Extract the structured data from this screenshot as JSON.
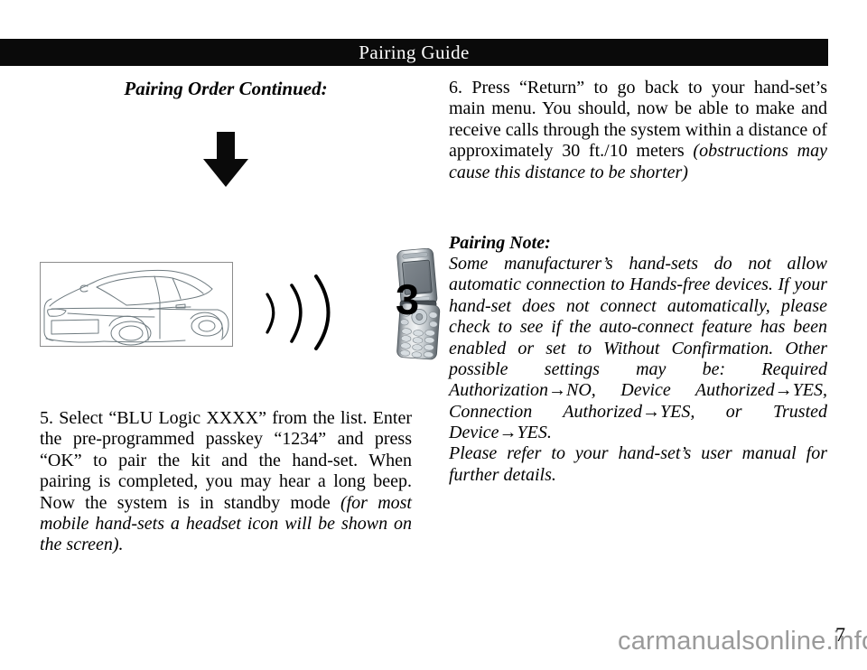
{
  "header": {
    "title": "Pairing Guide"
  },
  "left_column": {
    "heading": "Pairing Order Continued:",
    "arrow_icon": "down-arrow-icon",
    "illustration": {
      "car_alt": "car-line-drawing",
      "signal_alt": "bluetooth-signal-waves",
      "phone_alt": "flip-phone-illustration",
      "step_number": "3"
    },
    "step5": {
      "text_plain": "5. Select “BLU Logic XXXX” from the list. Enter the pre-programmed passkey “1234” and press “OK” to pair the kit and the hand-set. When pairing is completed, you may hear a long beep.  Now the system is in standby mode ",
      "text_italic": "(for most mobile hand-sets a headset icon  will be shown on the screen)."
    }
  },
  "right_column": {
    "step6": {
      "text_plain": "6. Press “Return” to go back to your hand-set’s main menu.  You should, now be able to make and receive calls through the system within a distance of approximately 30 ft./10 meters ",
      "text_italic": "(obstructions may cause this distance to be shorter)"
    },
    "pairing_note": {
      "heading": "Pairing Note:",
      "paragraph1": "Some manufacturer’s hand-sets do not allow automatic connection to Hands-free devices. If your hand-set does not connect automatically, please check to see if the auto-connect feature has been enabled or set to Without Confirmation.  Other possible settings may be: Required Authorization→NO, Device Authorized→YES, Connection Authorized→YES, or Trusted Device→YES.",
      "paragraph2": "Please refer to your hand-set’s user manual for further details."
    }
  },
  "footer": {
    "watermark": "carmanualsonline.info",
    "page_number": "7"
  },
  "colors": {
    "banner_background": "#0a0a0a",
    "banner_text": "#ffffff",
    "body_text": "#000000",
    "watermark_text": "#9a9a9a",
    "figure_border": "#8c8c8c"
  }
}
